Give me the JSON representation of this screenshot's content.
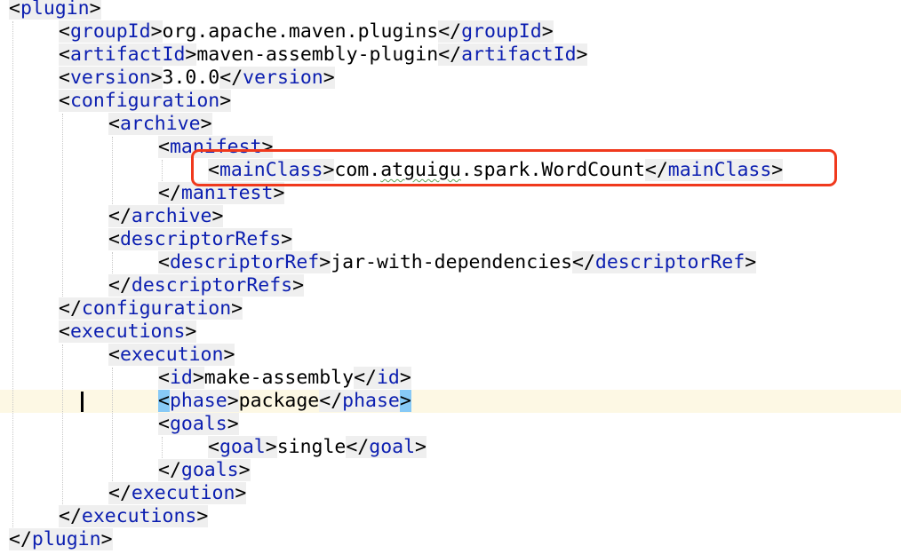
{
  "editor": {
    "lines": [
      {
        "open": "plugin"
      },
      {
        "open": "groupId",
        "text": "org.apache.maven.plugins",
        "close": "groupId"
      },
      {
        "open": "artifactId",
        "text": "maven-assembly-plugin",
        "close": "artifactId"
      },
      {
        "open": "version",
        "text": "3.0.0",
        "close": "version"
      },
      {
        "open": "configuration"
      },
      {
        "open": "archive"
      },
      {
        "open": "manifest"
      },
      {
        "open": "mainClass",
        "text_a": "com.",
        "text_b": "atguigu",
        "text_c": ".spark.WordCount",
        "close": "mainClass"
      },
      {
        "close": "manifest"
      },
      {
        "close": "archive"
      },
      {
        "open": "descriptorRefs"
      },
      {
        "open": "descriptorRef",
        "text": "jar-with-dependencies",
        "close": "descriptorRef"
      },
      {
        "close": "descriptorRefs"
      },
      {
        "close": "configuration"
      },
      {
        "open": "executions"
      },
      {
        "open": "execution"
      },
      {
        "open": "id",
        "text": "make-assembly",
        "close": "id"
      },
      {
        "open": "phase",
        "text": "package",
        "close": "phase"
      },
      {
        "open": "goals"
      },
      {
        "open": "goal",
        "text": "single",
        "close": "goal"
      },
      {
        "close": "goals"
      },
      {
        "close": "execution"
      },
      {
        "close": "executions"
      },
      {
        "close": "plugin"
      }
    ]
  },
  "colors": {
    "tag_name": "#0b1eb0",
    "tag_background": "#efefef",
    "bracket_match": "#87c9f6",
    "current_line": "#fdf8e4",
    "annotation_box": "#f0391d",
    "spelling_squiggle": "#5aa35a"
  }
}
